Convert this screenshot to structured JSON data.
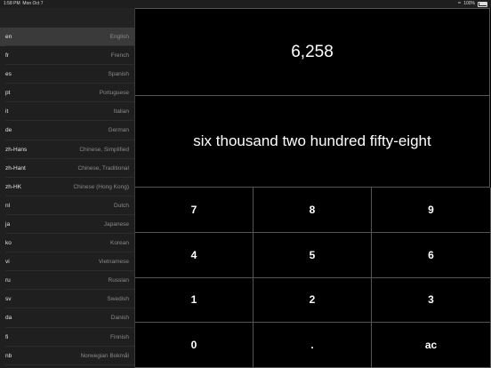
{
  "statusbar": {
    "time": "1:58 PM",
    "date": "Mon Oct 7",
    "battery": "100%",
    "wifi_icon": "wifi-icon",
    "battery_icon": "battery-icon"
  },
  "sidebar": {
    "selected": "en",
    "languages": [
      {
        "code": "en",
        "name": "English"
      },
      {
        "code": "fr",
        "name": "French"
      },
      {
        "code": "es",
        "name": "Spanish"
      },
      {
        "code": "pt",
        "name": "Portuguese"
      },
      {
        "code": "it",
        "name": "Italian"
      },
      {
        "code": "de",
        "name": "German"
      },
      {
        "code": "zh-Hans",
        "name": "Chinese, Simplified"
      },
      {
        "code": "zh-Hant",
        "name": "Chinese, Traditional"
      },
      {
        "code": "zh-HK",
        "name": "Chinese (Hong Kong)"
      },
      {
        "code": "nl",
        "name": "Dutch"
      },
      {
        "code": "ja",
        "name": "Japanese"
      },
      {
        "code": "ko",
        "name": "Korean"
      },
      {
        "code": "vi",
        "name": "Vietnamese"
      },
      {
        "code": "ru",
        "name": "Russian"
      },
      {
        "code": "sv",
        "name": "Swedish"
      },
      {
        "code": "da",
        "name": "Danish"
      },
      {
        "code": "fi",
        "name": "Finnish"
      },
      {
        "code": "nb",
        "name": "Norwegian Bokmål"
      }
    ]
  },
  "display": {
    "number": "6,258",
    "words": "six thousand two hundred fifty-eight"
  },
  "keypad": {
    "keys": [
      "7",
      "8",
      "9",
      "4",
      "5",
      "6",
      "1",
      "2",
      "3",
      "0",
      ".",
      "ac"
    ]
  },
  "colors": {
    "background": "#000000",
    "sidebar_bg": "#1f1f1f",
    "selected_row": "#3a3a3a",
    "grid_line": "#555555",
    "secondary_text": "#8a8a8a"
  }
}
